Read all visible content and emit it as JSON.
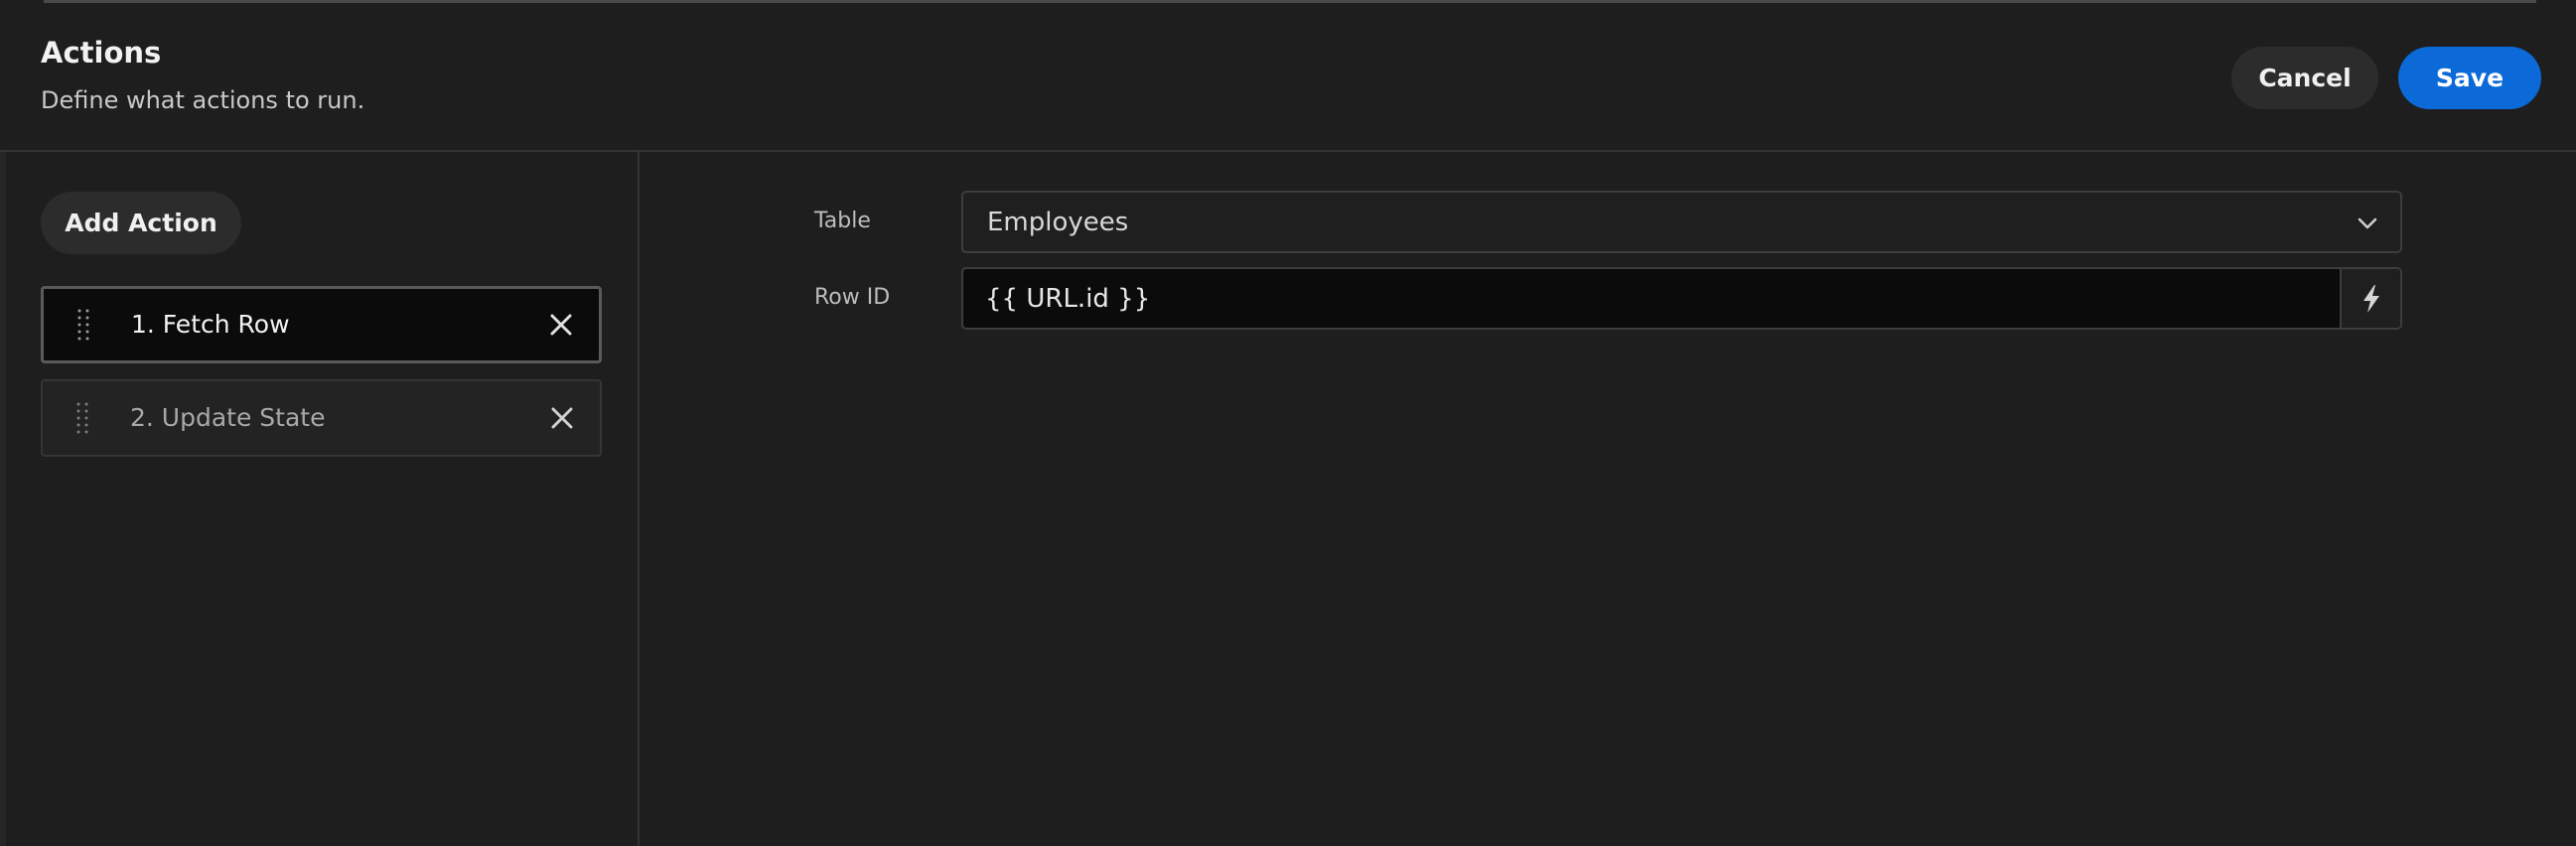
{
  "header": {
    "title": "Actions",
    "subtitle": "Define what actions to run.",
    "cancel_label": "Cancel",
    "save_label": "Save"
  },
  "sidebar": {
    "add_action_label": "Add Action",
    "actions": [
      {
        "label": "1. Fetch Row",
        "selected": true
      },
      {
        "label": "2. Update State",
        "selected": false
      }
    ]
  },
  "settings": {
    "table": {
      "label": "Table",
      "value": "Employees",
      "icon": "chevron-down-icon"
    },
    "row_id": {
      "label": "Row ID",
      "value": "{{ URL.id }}",
      "binding_icon": "lightning-icon"
    }
  },
  "colors": {
    "background": "#1e1e1e",
    "primary_button": "#0c6ad8",
    "secondary_button": "#2c2c2c",
    "selected_item_bg": "#0b0b0b"
  }
}
